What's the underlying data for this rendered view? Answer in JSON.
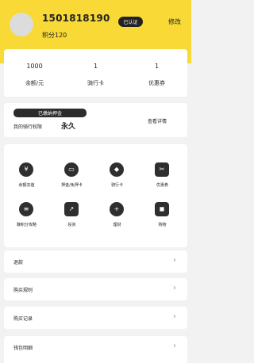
{
  "header": {
    "phone": "1501818190",
    "points": "积分120",
    "verified_badge": "已认证",
    "edit_label": "修改",
    "background_color": "#f8d936"
  },
  "stats": [
    {
      "value": "1000",
      "label": "余额/元"
    },
    {
      "value": "1",
      "label": "骑行卡"
    },
    {
      "value": "1",
      "label": "优惠券"
    }
  ],
  "permission": {
    "badge": "已缴纳押金",
    "label": "我的骑行权限",
    "value": "永久",
    "detail": "查看详情"
  },
  "grid": [
    {
      "label": "余额充值",
      "icon": "yen-icon",
      "glyph": "¥"
    },
    {
      "label": "押金/免押卡",
      "icon": "card-icon",
      "glyph": "▭"
    },
    {
      "label": "骑行卡",
      "icon": "tag-icon",
      "glyph": "◆"
    },
    {
      "label": "优惠券",
      "icon": "ticket-icon",
      "glyph": "✂"
    },
    {
      "label": "赚积分攻略",
      "icon": "database-icon",
      "glyph": "≡"
    },
    {
      "label": "投资",
      "icon": "chart-icon",
      "glyph": "↗"
    },
    {
      "label": "理财",
      "icon": "plus-icon",
      "glyph": "+"
    },
    {
      "label": "购物",
      "icon": "shopping-bag-icon",
      "glyph": "◼"
    }
  ],
  "menu_rows": [
    {
      "label": "退款"
    },
    {
      "label": "购买规则"
    },
    {
      "label": "购买记录"
    },
    {
      "label": "钱包明细"
    }
  ],
  "chevron": "›"
}
